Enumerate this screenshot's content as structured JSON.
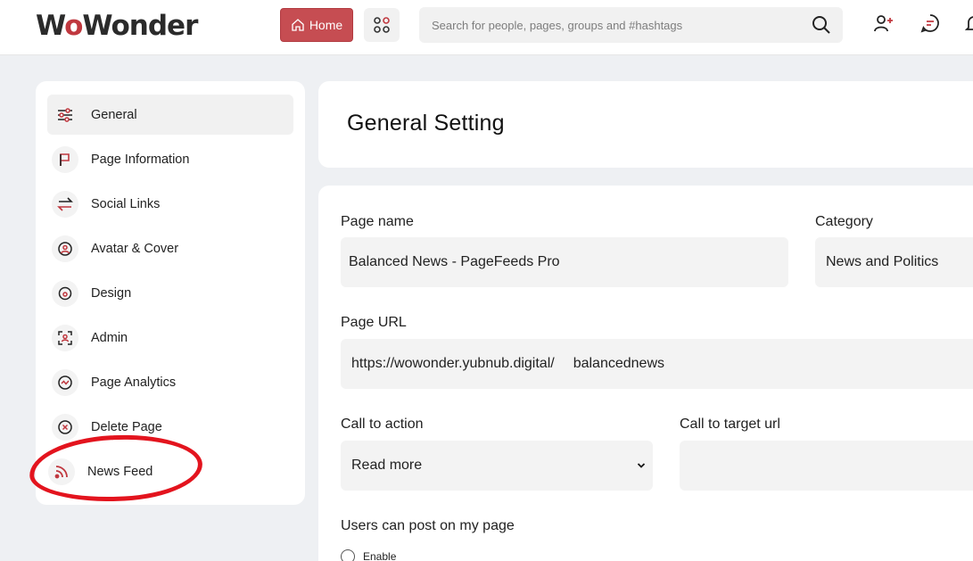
{
  "header": {
    "logo_text": "WoWonder",
    "home_label": "Home",
    "search_placeholder": "Search for people, pages, groups and #hashtags"
  },
  "sidebar": {
    "items": [
      {
        "label": "General",
        "icon": "sliders-icon"
      },
      {
        "label": "Page Information",
        "icon": "flag-icon"
      },
      {
        "label": "Social Links",
        "icon": "arrows-swap-icon"
      },
      {
        "label": "Avatar & Cover",
        "icon": "image-icon"
      },
      {
        "label": "Design",
        "icon": "palette-icon"
      },
      {
        "label": "Admin",
        "icon": "user-scan-icon"
      },
      {
        "label": "Page Analytics",
        "icon": "analytics-icon"
      },
      {
        "label": "Delete Page",
        "icon": "delete-circle-icon"
      },
      {
        "label": "News Feed",
        "icon": "rss-icon"
      }
    ],
    "active_index": 0
  },
  "main": {
    "title": "General Setting",
    "page_name": {
      "label": "Page name",
      "value": "Balanced News - PageFeeds Pro"
    },
    "category": {
      "label": "Category",
      "value": "News and Politics"
    },
    "page_url": {
      "label": "Page URL",
      "prefix": "https://wowonder.yubnub.digital/",
      "value": "balancednews"
    },
    "call_to_action": {
      "label": "Call to action",
      "value": "Read more"
    },
    "call_to_target": {
      "label": "Call to target url",
      "value": ""
    },
    "users_can_post": {
      "label": "Users can post on my page",
      "option_enable": "Enable"
    }
  },
  "colors": {
    "accent": "#c64d52",
    "highlight": "#e3141e",
    "icon_red": "#c0383f"
  }
}
